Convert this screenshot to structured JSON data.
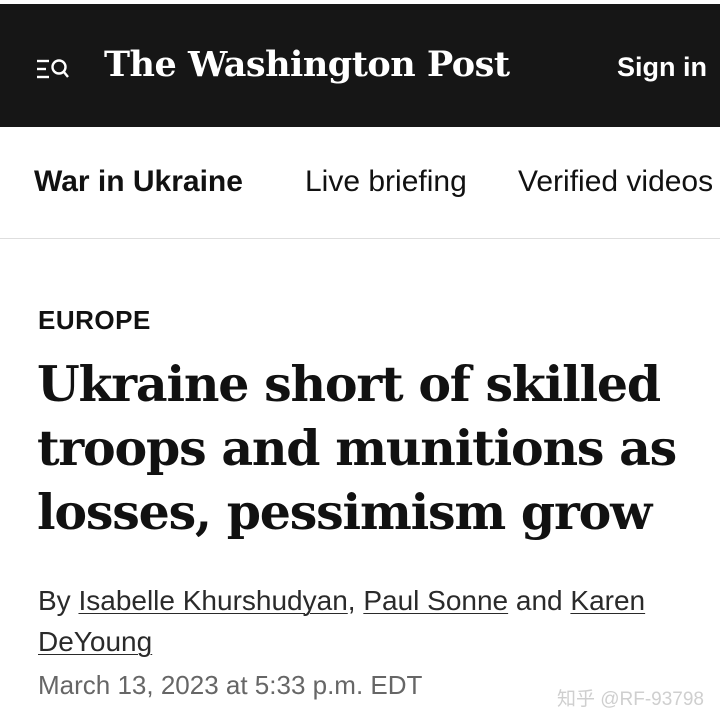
{
  "header": {
    "menu_icon": "menu-search-icon",
    "masthead": "The Washington Post",
    "sign_in_label": "Sign in",
    "background_color": "#161616"
  },
  "subnav": {
    "items": [
      {
        "label": "War in Ukraine",
        "active": true
      },
      {
        "label": "Live briefing",
        "active": false
      },
      {
        "label": "Verified videos",
        "active": false
      }
    ]
  },
  "article": {
    "kicker": "EUROPE",
    "headline": "Ukraine short of skilled troops and munitions as losses, pessimism grow",
    "byline": {
      "prefix": "By",
      "authors": [
        "Isabelle Khurshudyan",
        "Paul Sonne",
        "Karen DeYoung"
      ],
      "separator": ",",
      "conjunction": "and"
    },
    "timestamp": "March 13, 2023 at 5:33 p.m. EDT"
  },
  "watermark": "知乎 @RF-93798"
}
